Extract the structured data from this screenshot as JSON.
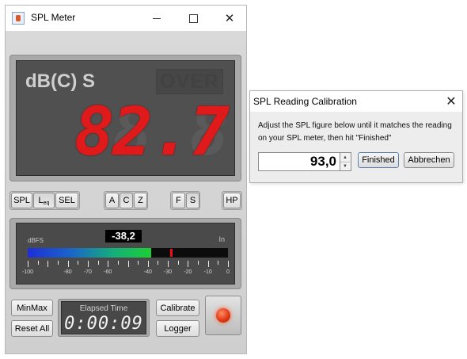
{
  "main_window": {
    "title": "SPL Meter",
    "controls": {
      "minimize": "—",
      "maximize": "☐",
      "close": "✕"
    }
  },
  "display": {
    "unit_label": "dB(C) S",
    "over_label": "OVER",
    "ghost_digits": "88.8",
    "spl_value": "82.7"
  },
  "weighting_buttons": {
    "spl": "SPL",
    "leq_main": "L",
    "leq_sub": "eq",
    "sel": "SEL",
    "a": "A",
    "c": "C",
    "z": "Z",
    "f": "F",
    "s": "S",
    "hp": "HP"
  },
  "meter": {
    "scale_label": "dBFS",
    "input_label": "In",
    "readout": "-38,2",
    "level_dbfs": -38.2,
    "peak_dbfs": -29,
    "range": [
      -100,
      0
    ],
    "tick_labels": [
      "-100",
      "-80",
      "-70",
      "-60",
      "-40",
      "-30",
      "-20",
      "-10",
      "0"
    ],
    "tick_values": [
      -100,
      -80,
      -70,
      -60,
      -40,
      -30,
      -20,
      -10,
      0
    ]
  },
  "bottom": {
    "minmax_label": "MinMax",
    "reset_label": "Reset All",
    "elapsed_label": "Elapsed Time",
    "elapsed_value": "0:00:09",
    "calibrate_label": "Calibrate",
    "logger_label": "Logger"
  },
  "dialog": {
    "title": "SPL Reading Calibration",
    "close": "✕",
    "message": "Adjust the SPL figure below until it matches the reading on your SPL meter, then hit \"Finished\"",
    "value": "93,0",
    "up_arrow": "▲",
    "down_arrow": "▼",
    "finished_label": "Finished",
    "cancel_label": "Abbrechen"
  }
}
